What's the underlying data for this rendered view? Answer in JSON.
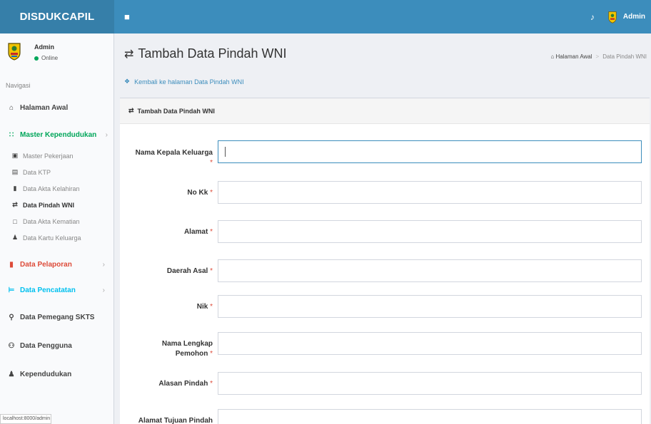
{
  "header": {
    "brand": "DISDUKCAPIL",
    "menu_icon": "bars-icon",
    "bell_icon": "bell-icon",
    "user_name": "Admin"
  },
  "sidebar": {
    "user": {
      "name": "Admin",
      "status": "Online"
    },
    "nav_header": "Navigasi",
    "items": [
      {
        "label": "Halaman Awal",
        "icon": "home-icon"
      },
      {
        "label": "Master Kependudukan",
        "icon": "grid-icon",
        "color": "#00a65a"
      },
      {
        "label": "Data Pelaporan",
        "icon": "book-icon",
        "color": "#dd4b39"
      },
      {
        "label": "Data Pencatatan",
        "icon": "text-cursor-icon",
        "color": "#00c0ef"
      },
      {
        "label": "Data Pemegang SKTS",
        "icon": "search-icon"
      },
      {
        "label": "Data Pengguna",
        "icon": "users-icon"
      },
      {
        "label": "Kependudukan",
        "icon": "user-icon"
      }
    ],
    "sub_items": [
      {
        "label": "Master Pekerjaan",
        "icon": "save-icon"
      },
      {
        "label": "Data KTP",
        "icon": "id-card-icon"
      },
      {
        "label": "Data Akta Kelahiran",
        "icon": "book-icon"
      },
      {
        "label": "Data Pindah WNI",
        "icon": "exchange-icon"
      },
      {
        "label": "Data Akta Kematian",
        "icon": "square-icon"
      },
      {
        "label": "Data Kartu Keluarga",
        "icon": "user-icon"
      }
    ],
    "status_url": "localhost:8000/admin"
  },
  "main": {
    "title": "Tambah Data Pindah WNI",
    "breadcrumb": {
      "home": "Halaman Awal",
      "current": "Data Pindah WNI"
    },
    "back_link": "Kembali ke halaman Data Pindah WNI",
    "box_title": "Tambah Data Pindah WNI",
    "fields": [
      {
        "label": "Nama Kepala Keluarga",
        "required": "*",
        "value": ""
      },
      {
        "label": "No Kk",
        "required": "*",
        "value": ""
      },
      {
        "label": "Alamat",
        "required": "*",
        "value": ""
      },
      {
        "label": "Daerah Asal",
        "required": "*",
        "value": ""
      },
      {
        "label": "Nik",
        "required": "*",
        "value": ""
      },
      {
        "label": "Nama Lengkap Pemohon",
        "label_line1": "Nama Lengkap",
        "label_line2": "Pemohon",
        "required": "*",
        "value": ""
      },
      {
        "label": "Alasan Pindah",
        "required": "*",
        "value": ""
      },
      {
        "label": "Alamat Tujuan Pindah",
        "required": "",
        "value": ""
      }
    ]
  },
  "colors": {
    "header": "#3c8dbc",
    "brand": "#367fa9",
    "online": "#00a65a",
    "required": "#dd4b39",
    "link": "#3c8dbc"
  }
}
